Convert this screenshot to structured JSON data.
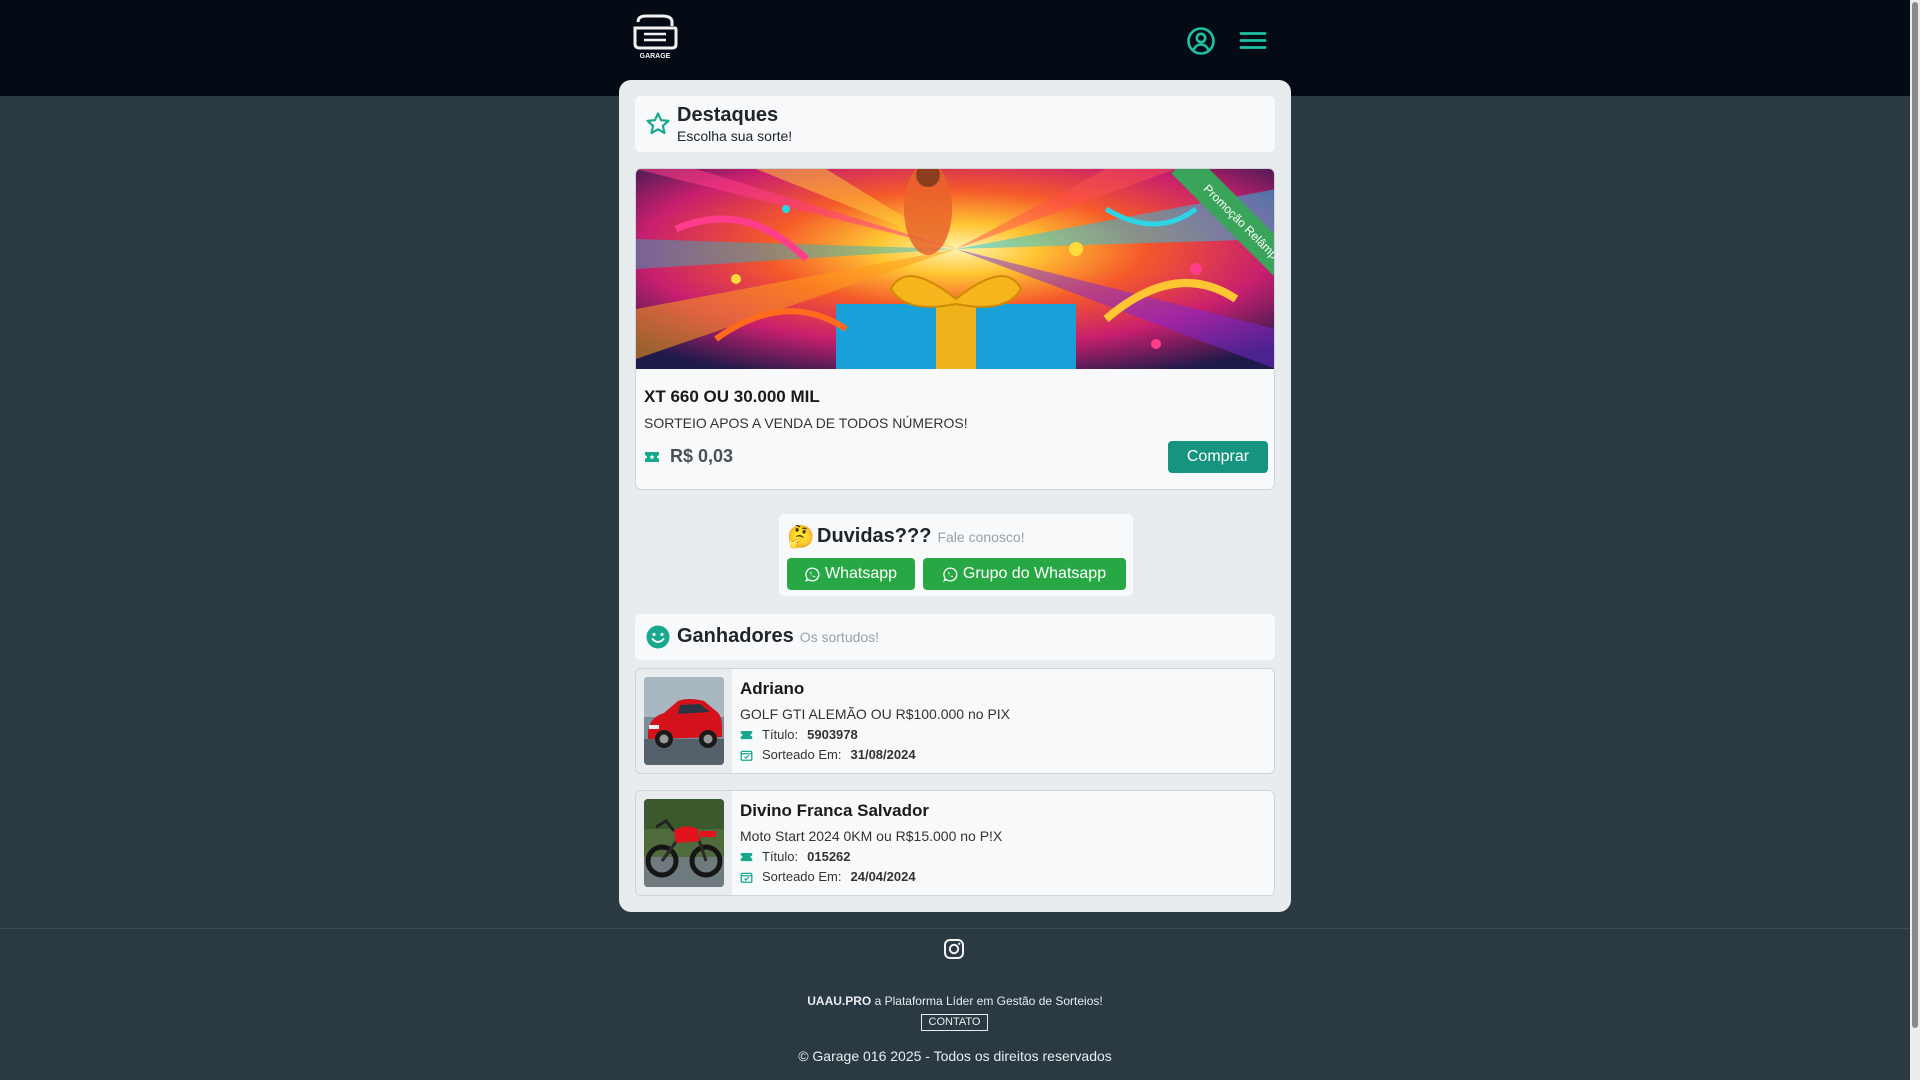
{
  "header": {
    "logo_text": "GARAGE",
    "user_icon": "user-circle-icon",
    "menu_icon": "hamburger-menu-icon"
  },
  "destaques": {
    "title": "Destaques",
    "subtitle": "Escolha sua sorte!",
    "icon": "star-icon"
  },
  "raffle": {
    "ribbon": "Promoção Relâmpago!",
    "title": "XT 660 OU 30.000 MIL",
    "description": "SORTEIO APOS A VENDA DE TODOS NÚMEROS!",
    "price": "R$ 0,03",
    "buy_label": "Comprar",
    "ticket_icon": "ticket-icon"
  },
  "doubts": {
    "emoji": "🤔",
    "title": "Duvidas???",
    "subtitle": "Fale conosco!",
    "whatsapp_label": "Whatsapp",
    "group_label": "Grupo do Whatsapp"
  },
  "winners": {
    "title": "Ganhadores",
    "subtitle": "Os sortudos!",
    "icon": "smile-icon",
    "title_label": "Título:",
    "drawn_label": "Sorteado Em:",
    "items": [
      {
        "name": "Adriano",
        "prize": "GOLF GTI ALEMÃO OU R$100.000 no PIX",
        "ticket": "5903978",
        "date": "31/08/2024"
      },
      {
        "name": "Divino Franca Salvador",
        "prize": "Moto Start 2024 0KM ou R$15.000 no P!X",
        "ticket": "015262",
        "date": "24/04/2024"
      }
    ]
  },
  "footer": {
    "brand": "UAAU.PRO",
    "tagline": "a Plataforma Líder em Gestão de Sorteios!",
    "contact": "CONTATO",
    "copyright": "© Garage 016 2025 - Todos os direitos reservados",
    "instagram_icon": "instagram-icon"
  },
  "colors": {
    "topbar": "#050b15",
    "background": "#2b3a42",
    "accent": "#17947f",
    "whatsapp_green": "#28a745"
  }
}
